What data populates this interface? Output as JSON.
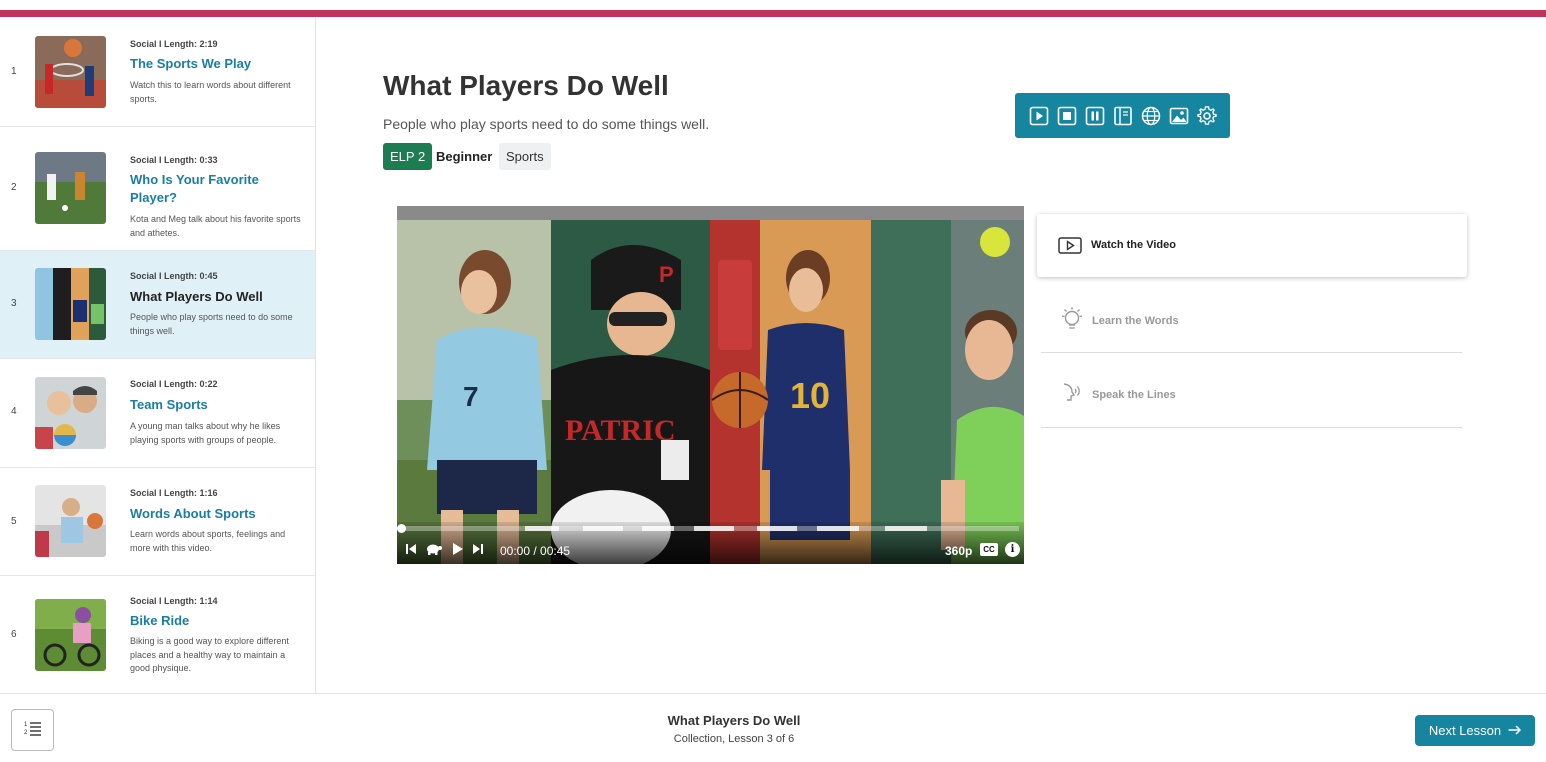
{
  "colors": {
    "accent_stripe": "#c1325f",
    "link": "#1a7ea2",
    "toolbar": "#1585a0",
    "elp_tag": "#1d7d52",
    "active_row": "#dff0f6"
  },
  "sidebar": {
    "items": [
      {
        "num": "1",
        "meta": "Social I Length: 2:19",
        "title": "The Sports We Play",
        "desc": "Watch this to learn words about different sports."
      },
      {
        "num": "2",
        "meta": "Social I Length: 0:33",
        "title": "Who Is Your Favorite Player?",
        "desc": "Kota and Meg talk about his favorite sports and athetes."
      },
      {
        "num": "3",
        "meta": "Social I Length: 0:45",
        "title": "What Players Do Well",
        "desc": "People who play sports need to do some things well.",
        "active": true
      },
      {
        "num": "4",
        "meta": "Social I Length: 0:22",
        "title": "Team Sports",
        "desc": "A young man talks about why he likes playing sports with groups of people."
      },
      {
        "num": "5",
        "meta": "Social I Length: 1:16",
        "title": "Words About Sports",
        "desc": "Learn words about sports, feelings and more with this video."
      },
      {
        "num": "6",
        "meta": "Social I Length: 1:14",
        "title": "Bike Ride",
        "desc": "Biking is a good way to explore different places and a healthy way to maintain a good physique."
      }
    ]
  },
  "main": {
    "title": "What Players Do Well",
    "subtitle": "People who play sports need to do some things well.",
    "tags": {
      "elp": "ELP 2",
      "level": "Beginner",
      "topic": "Sports"
    }
  },
  "tts_toolbar": {
    "icons": [
      "play-icon",
      "stop-icon",
      "pause-icon",
      "reading-icon",
      "globe-icon",
      "image-icon",
      "gear-icon"
    ]
  },
  "video": {
    "time": "00:00 / 00:45",
    "progress_fraction": 0.0,
    "quality": "360p",
    "cc": "CC",
    "info": "i",
    "jersey_numbers": [
      "7",
      "10"
    ]
  },
  "steps": [
    {
      "label": "Watch the Video",
      "icon": "video-icon",
      "active": true
    },
    {
      "label": "Learn the Words",
      "icon": "lightbulb-icon",
      "active": false
    },
    {
      "label": "Speak the Lines",
      "icon": "speak-icon",
      "active": false
    }
  ],
  "footer": {
    "title": "What Players Do Well",
    "subtitle": "Collection, Lesson 3 of 6",
    "next_label": "Next Lesson"
  }
}
